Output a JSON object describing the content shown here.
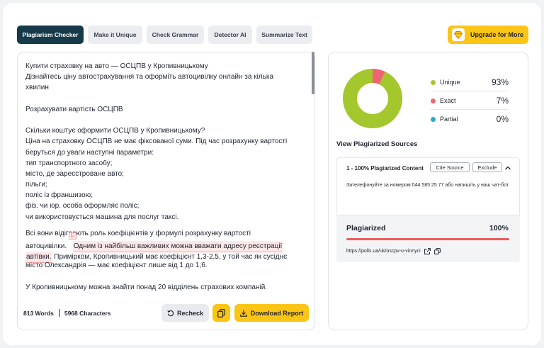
{
  "tabs": [
    {
      "label": "Plagiarism Checker",
      "active": true
    },
    {
      "label": "Make it Unique",
      "active": false
    },
    {
      "label": "Check Grammar",
      "active": false
    },
    {
      "label": "Detector AI",
      "active": false
    },
    {
      "label": "Summarize Text",
      "active": false
    }
  ],
  "upgrade": {
    "label": "Upgrade for More",
    "icon": "gem-icon"
  },
  "editor": {
    "lines": [
      "Купити страховку на авто — ОСЦПВ у Кропивницькому",
      "Дізнайтесь ціну автострахування та оформіть автоцивілку онлайн за кілька",
      "хвилин",
      "Розрахувати вартість ОСЦПВ",
      "Скільки коштує оформити ОСЦПВ у Кропивницькому?",
      "Ціна на страховку ОСЦПВ не має фіксованої суми. Під час розрахунку вартості",
      "беруться до уваги наступні параметри:",
      "тип транспортного засобу;",
      "місто, де зареєстроване авто;",
      "пільги;",
      "поліс із франшизою;",
      "фіз. чи юр. особа оформляє поліс;",
      "чи використовується машина для послуг таксі.",
      "Всі вони відіграють роль коефіцієнтів у формулі розрахунку вартості",
      "автоцивілки.",
      "Примірком, Кропивницький має коефіцієнт 1,3-2,5, у той час як сусіднє",
      "місто Олександрія — має коефіцієнт лише від 1 до 1,6.",
      "У Кропивницькому можна знайти понад 20 відділень страхових компаній."
    ],
    "highlight": {
      "number": "1.",
      "line1": "Одним із найбільш важливих можна вважати адресу реєстрації",
      "line2": "автівки."
    }
  },
  "stats": {
    "words": "813 Words",
    "characters": "5968 Characters"
  },
  "actions": {
    "recheck": "Recheck",
    "download": "Download Report"
  },
  "results": {
    "legend": [
      {
        "label": "Unique",
        "value": "93%",
        "color": "#a3c72c"
      },
      {
        "label": "Exact",
        "value": "7%",
        "color": "#ef6473"
      },
      {
        "label": "Partial",
        "value": "0%",
        "color": "#2aa7c9"
      }
    ],
    "chart_values": {
      "unique": 93,
      "exact": 7,
      "partial": 0
    },
    "sources_title": "View Plagiarized Sources",
    "source": {
      "heading": "1 - 100% Plagiarized Content",
      "cite": "Cite Source",
      "exclude": "Exclude",
      "snippet": "Зателефонуйте за номером 044 585 25 77 або напишіть у наш чат-бот.",
      "plagiarized_label": "Plagiarized",
      "plagiarized_value": "100%",
      "plagiarized_fraction": 1.0,
      "url": "https://polis.ua/uk/oscpv-u-vinnyci"
    }
  }
}
